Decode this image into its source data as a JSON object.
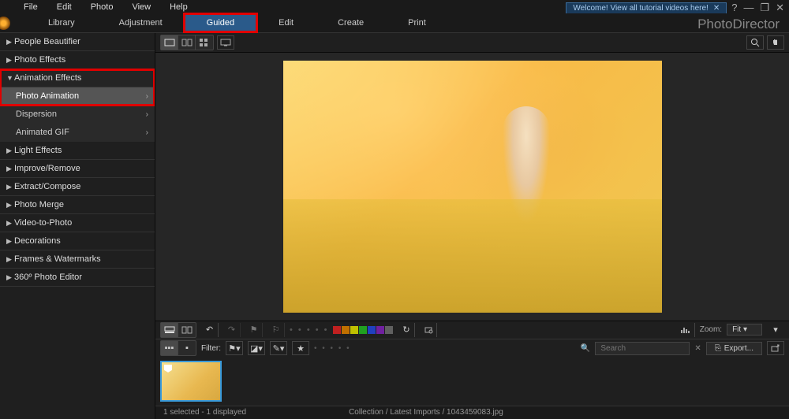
{
  "menubar": {
    "items": [
      "File",
      "Edit",
      "Photo",
      "View",
      "Help"
    ]
  },
  "welcome": {
    "text": "Welcome! View all tutorial videos here!",
    "close": "✕"
  },
  "winControls": {
    "help": "?",
    "min": "—",
    "max": "❐",
    "close": "✕"
  },
  "modeTabs": {
    "items": [
      "Library",
      "Adjustment",
      "Guided",
      "Edit",
      "Create",
      "Print"
    ],
    "active": "Guided"
  },
  "brand": "PhotoDirector",
  "sidebar": {
    "categories": [
      {
        "label": "People Beautifier",
        "expanded": false
      },
      {
        "label": "Photo Effects",
        "expanded": false
      },
      {
        "label": "Animation Effects",
        "expanded": true,
        "items": [
          {
            "label": "Photo Animation",
            "selected": true
          },
          {
            "label": "Dispersion",
            "selected": false
          },
          {
            "label": "Animated GIF",
            "selected": false
          }
        ]
      },
      {
        "label": "Light Effects",
        "expanded": false
      },
      {
        "label": "Improve/Remove",
        "expanded": false
      },
      {
        "label": "Extract/Compose",
        "expanded": false
      },
      {
        "label": "Photo Merge",
        "expanded": false
      },
      {
        "label": "Video-to-Photo",
        "expanded": false
      },
      {
        "label": "Decorations",
        "expanded": false
      },
      {
        "label": "Frames & Watermarks",
        "expanded": false
      },
      {
        "label": "360º Photo Editor",
        "expanded": false
      }
    ]
  },
  "stripTools": {
    "swatches": [
      "#c02020",
      "#c07000",
      "#c0c000",
      "#20a020",
      "#2040c0",
      "#7020a0",
      "#606060"
    ],
    "zoomLabel": "Zoom:",
    "zoomValue": "Fit"
  },
  "filterBar": {
    "filterLabel": "Filter:",
    "searchPlaceholder": "Search",
    "exportLabel": "Export..."
  },
  "status": {
    "left": "1 selected - 1 displayed",
    "mid": "Collection / Latest Imports / 1043459083.jpg"
  }
}
